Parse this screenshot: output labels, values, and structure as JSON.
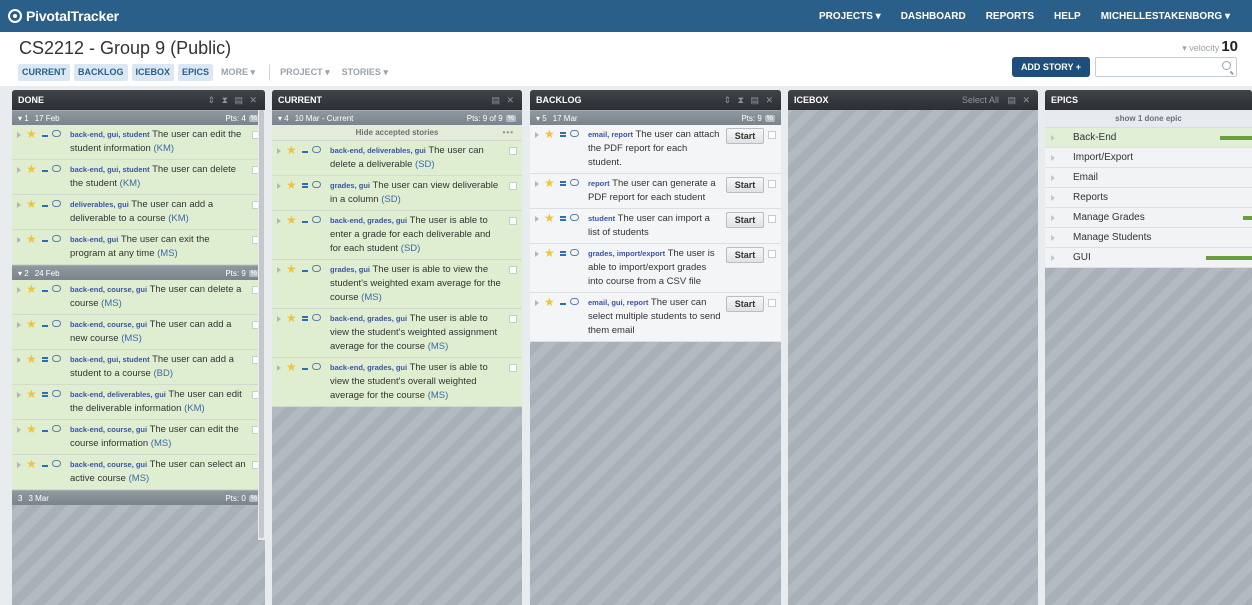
{
  "app": {
    "logo": "PivotalTracker"
  },
  "topnav": [
    "PROJECTS ▾",
    "DASHBOARD",
    "REPORTS",
    "HELP",
    "MICHELLESTAKENBORG ▾"
  ],
  "project": {
    "title": "CS2212 - Group 9 (Public)",
    "tabs": [
      "CURRENT",
      "BACKLOG",
      "ICEBOX",
      "EPICS"
    ],
    "more": "MORE ▾",
    "menus": [
      "PROJECT ▾",
      "STORIES ▾"
    ],
    "velocity_label": "▾ velocity",
    "velocity_value": "10",
    "add_story": "ADD STORY +",
    "search_placeholder": ""
  },
  "panels": {
    "done": {
      "title": "DONE",
      "icons": "⇕ ⧗ ▤ ✕",
      "iterations": [
        {
          "num": "▾ 1",
          "date": "17 Feb",
          "pts": "Pts: 4",
          "pct": "%",
          "stories": [
            {
              "labels": "back-end, gui, student",
              "title": "The user can edit the student information",
              "owner": "(KM)",
              "est": 1
            },
            {
              "labels": "back-end, gui, student",
              "title": "The user can delete the student",
              "owner": "(KM)",
              "est": 1
            },
            {
              "labels": "deliverables, gui",
              "title": "The user can add a deliverable to a course",
              "owner": "(KM)",
              "est": 1
            },
            {
              "labels": "back-end, gui",
              "title": "The user can exit the program at any time",
              "owner": "(MS)",
              "est": 1
            }
          ]
        },
        {
          "num": "▾ 2",
          "date": "24 Feb",
          "pts": "Pts: 9",
          "pct": "%",
          "stories": [
            {
              "labels": "back-end, course, gui",
              "title": "The user can delete a course",
              "owner": "(MS)",
              "est": 1
            },
            {
              "labels": "back-end, course, gui",
              "title": "The user can add a new course",
              "owner": "(MS)",
              "est": 1
            },
            {
              "labels": "back-end, gui, student",
              "title": "The user can add a student to a course",
              "owner": "(BD)",
              "est": 2
            },
            {
              "labels": "back-end, deliverables, gui",
              "title": "The user can edit the deliverable information",
              "owner": "(KM)",
              "est": 2
            },
            {
              "labels": "back-end, course, gui",
              "title": "The user can edit the course information",
              "owner": "(MS)",
              "est": 1
            },
            {
              "labels": "back-end, course, gui",
              "title": "The user can select an active course",
              "owner": "(MS)",
              "est": 1
            }
          ]
        },
        {
          "num": "3",
          "date": "3 Mar",
          "pts": "Pts: 0",
          "pct": "%",
          "stories": []
        }
      ]
    },
    "current": {
      "title": "CURRENT",
      "icons": "▤ ✕",
      "iteration": {
        "num": "▾ 4",
        "date": "10 Mar - Current",
        "pts": "Pts: 9 of 9",
        "pct": "%"
      },
      "hide_accepted": "Hide accepted stories",
      "hide_dots": "•••",
      "stories": [
        {
          "labels": "back-end, deliverables, gui",
          "title": "The user can delete a deliverable",
          "owner": "(SD)",
          "est": 1
        },
        {
          "labels": "grades, gui",
          "title": "The user can view deliverable in a column",
          "owner": "(SD)",
          "est": 2
        },
        {
          "labels": "back-end, grades, gui",
          "title": "The user is able to enter a grade for each deliverable and for each student",
          "owner": "(SD)",
          "est": 1
        },
        {
          "labels": "grades, gui",
          "title": "The user is able to view the student's weighted exam average for the course",
          "owner": "(MS)",
          "est": 1
        },
        {
          "labels": "back-end, grades, gui",
          "title": "The user is able to view the student's weighted assignment average for the course",
          "owner": "(MS)",
          "est": 2
        },
        {
          "labels": "back-end, grades, gui",
          "title": "The user is able to view the student's overall weighted average for the course",
          "owner": "(MS)",
          "est": 1
        }
      ]
    },
    "backlog": {
      "title": "BACKLOG",
      "icons": "⇕ ⧗ ▤ ✕",
      "iteration": {
        "num": "▾ 5",
        "date": "17 Mar",
        "pts": "Pts: 9",
        "pct": "%"
      },
      "start_label": "Start",
      "stories": [
        {
          "labels": "email, report",
          "title": "The user can attach the PDF report for each student.",
          "est": 2
        },
        {
          "labels": "report",
          "title": "The user can generate a PDF report for each student",
          "est": 2
        },
        {
          "labels": "student",
          "title": "The user can import a list of students",
          "est": 2
        },
        {
          "labels": "grades, import/export",
          "title": "The user is able to import/export grades into course from a CSV file",
          "est": 2
        },
        {
          "labels": "email, gui, report",
          "title": "The user can select multiple students to send them email",
          "est": 1
        }
      ]
    },
    "icebox": {
      "title": "ICEBOX",
      "select_all": "Select All",
      "icons": "▤ ✕"
    },
    "epics": {
      "title": "EPICS",
      "show_done": "show 1 done epic",
      "items": [
        {
          "name": "Back-End",
          "progress": 0.7
        },
        {
          "name": "Import/Export",
          "progress": 0
        },
        {
          "name": "Email",
          "progress": 0
        },
        {
          "name": "Reports",
          "progress": 0
        },
        {
          "name": "Manage Grades",
          "progress": 0.2
        },
        {
          "name": "Manage Students",
          "progress": 0
        },
        {
          "name": "GUI",
          "progress": 1
        }
      ]
    }
  },
  "colors": {
    "topbar": "#2a5f8a",
    "accepted": "#dfeed0",
    "owner": "#3a6aa8",
    "label": "#3a55a5",
    "epic_bar": "#6a9e3a"
  }
}
